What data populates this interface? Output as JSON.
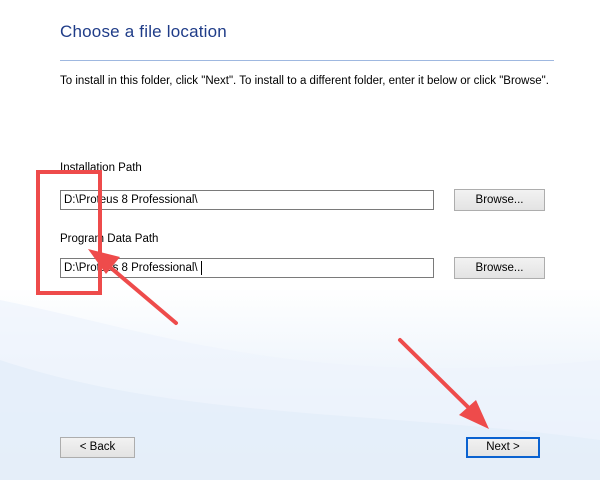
{
  "page": {
    "title": "Choose a file location",
    "instructions": "To install in this folder, click \"Next\". To install to a different folder, enter it below or click \"Browse\"."
  },
  "installation": {
    "label": "Installation Path",
    "value": "D:\\Proteus 8 Professional\\",
    "browse_label": "Browse..."
  },
  "program_data": {
    "label": "Program Data Path",
    "value": "D:\\Proteus 8 Professional\\",
    "browse_label": "Browse..."
  },
  "footer": {
    "back_label": "< Back",
    "next_label": "Next >"
  },
  "annotations": {
    "color": "#ee4b4b"
  }
}
